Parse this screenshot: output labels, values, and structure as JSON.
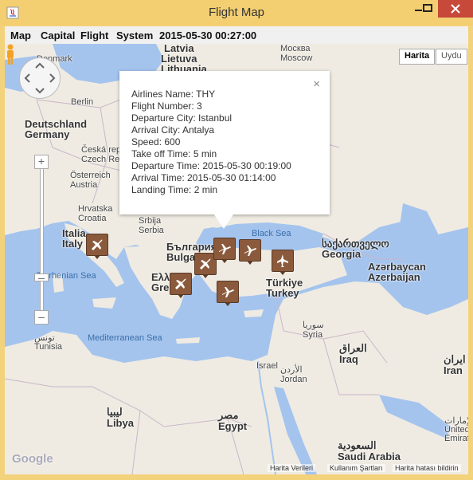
{
  "window": {
    "title": "Flight Map",
    "accent_color": "#f3cf72",
    "close_color": "#c7493a"
  },
  "menubar": {
    "items": [
      "Map",
      "Capital",
      "Flight",
      "System"
    ],
    "clock": "2015-05-30 00:27:00"
  },
  "map": {
    "map_type": {
      "map": "Harita",
      "satellite": "Uydu"
    },
    "labels": {
      "latvia": "Latvia",
      "lithuania": "Lietuva\nLithuania",
      "denmark": "Denmark",
      "berlin": "Berlin",
      "germany": "Deutschland\nGermany",
      "czech": "Česká repu\nCzech Rep",
      "austria": "Österreich\nAustria",
      "croatia": "Hrvatska\nCroatia",
      "italy": "Italia\nItaly",
      "serbia": "Srbija\nSerbia",
      "bulgaria": "България\nBulgaria",
      "greece": "Ελλ\nGreece",
      "turkey": "Türkiye\nTurkey",
      "georgia": "საქართველო\nGeorgia",
      "azerbaijan": "Azərbaycan\nAzerbaijan",
      "moscow": "Москва\nMoscow",
      "syria": "سوريا\nSyria",
      "iraq": "العراق\nIraq",
      "iran": "ایران\nIran",
      "israel": "Israel",
      "jordan": "الأردن\nJordan",
      "tunisia": "تونس\nTunisia",
      "libya": "ليبيا\nLibya",
      "egypt": "مصر\nEgypt",
      "saudi": "السعودية\nSaudi Arabia",
      "uae": "الإمارات\nUnited Ara\nEmirates",
      "black_sea": "Black Sea",
      "tyrrhenian": "Tyrrhenian Sea",
      "mediterranean": "Mediterranean Sea"
    },
    "google": "Google",
    "footer_data": "Harita Verileri",
    "footer_terms": "Kullanım Şartları",
    "footer_report": "Harita hatası bildirin",
    "info_window": {
      "lines": [
        "Airlines Name: THY",
        "Flight Number: 3",
        "Departure City: Istanbul",
        "Arrival City: Antalya",
        "Speed: 600",
        "Take off Time: 5 min",
        "Departure Time: 2015-05-30 00:19:00",
        "Arrival Time: 2015-05-30 01:14:00",
        "Landing Time: 2 min"
      ],
      "close": "×"
    },
    "marker_icon": "airplane-icon",
    "marker_color": "#8b5a3c"
  }
}
